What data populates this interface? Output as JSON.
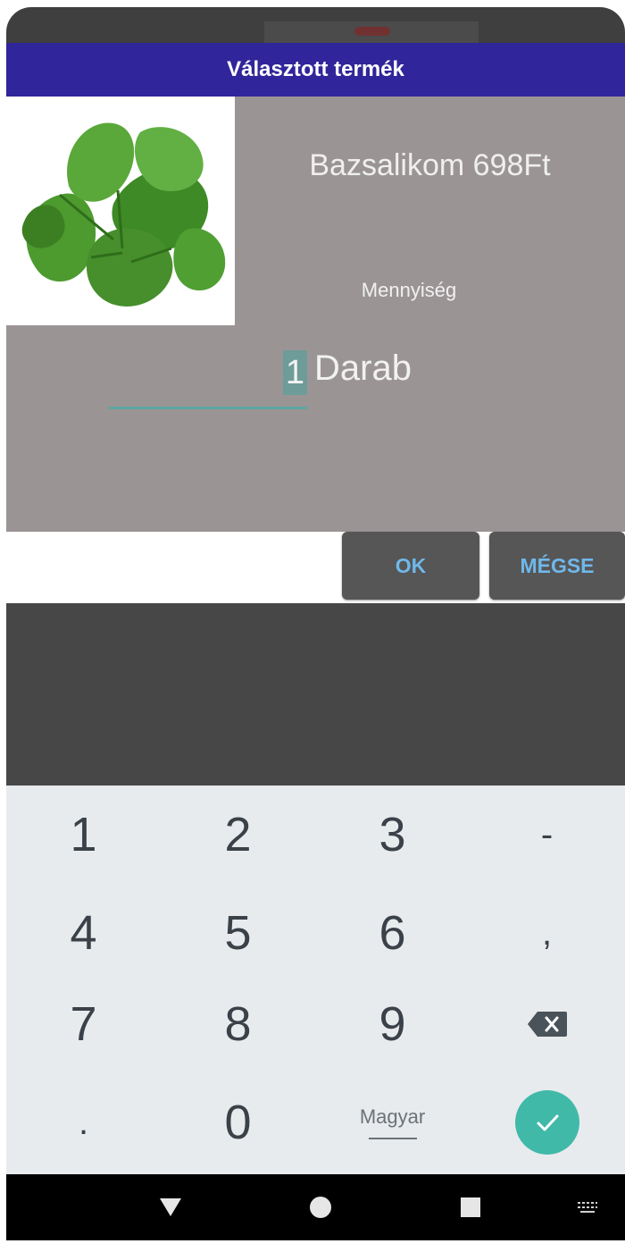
{
  "dialog": {
    "title": "Választott termék",
    "product_name": "Bazsalikom 698Ft",
    "quantity_label": "Mennyiség",
    "quantity_value": "1",
    "quantity_unit": "Darab",
    "ok_label": "OK",
    "cancel_label": "MÉGSE"
  },
  "keyboard": {
    "keys": [
      "1",
      "2",
      "3",
      "-",
      "4",
      "5",
      "6",
      ",",
      "7",
      "8",
      "9",
      ".",
      "0"
    ],
    "language": "Magyar",
    "backspace_icon": "backspace-icon",
    "enter_icon": "check-icon"
  },
  "navigation": {
    "icons": [
      "back-triangle-icon",
      "home-circle-icon",
      "recents-square-icon",
      "keyboard-switch-icon"
    ]
  },
  "colors": {
    "title_bar": "#30259a",
    "dialog_body": "#9b9495",
    "button_text": "#6fb8ea",
    "accent": "#40b9a8"
  }
}
